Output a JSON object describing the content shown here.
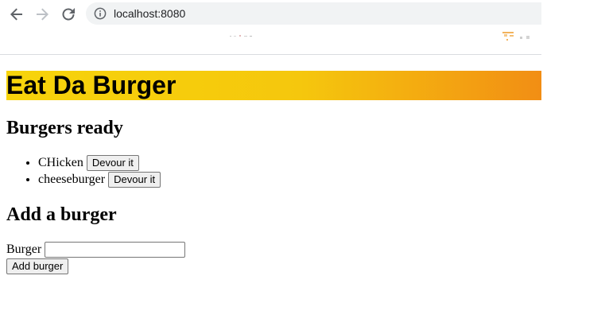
{
  "browser": {
    "url": "localhost:8080"
  },
  "page": {
    "banner_title": "Eat Da Burger",
    "ready_heading": "Burgers ready",
    "burgers": [
      {
        "name": "CHicken",
        "action_label": "Devour it"
      },
      {
        "name": "cheeseburger",
        "action_label": "Devour it"
      }
    ],
    "add_heading": "Add a burger",
    "form": {
      "field_label": "Burger",
      "field_value": "",
      "submit_label": "Add burger"
    }
  },
  "colors": {
    "banner_start": "#f7d40b",
    "banner_end": "#f28e14"
  }
}
